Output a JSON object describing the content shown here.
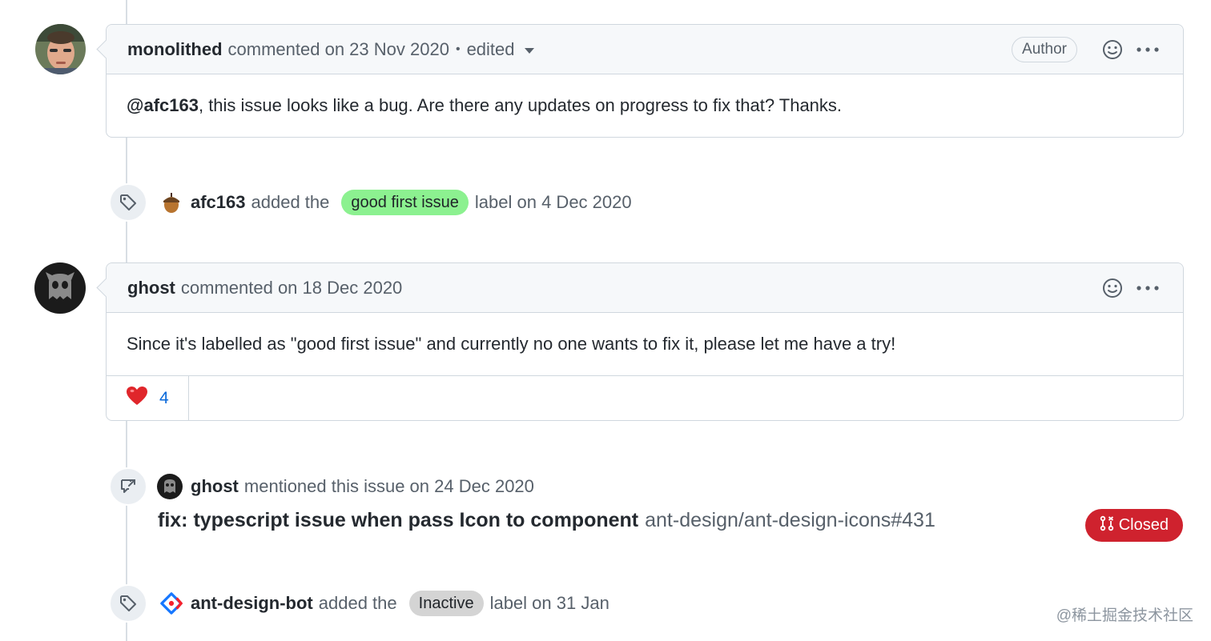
{
  "comments": [
    {
      "author": "monolithed",
      "meta": "commented on 23 Nov 2020",
      "dot": "•",
      "edited": "edited",
      "badge": "Author",
      "mention": "@afc163",
      "body": ", this issue looks like a bug. Are there any updates on progress to fix that? Thanks."
    },
    {
      "author": "ghost",
      "meta": "commented on 18 Dec 2020",
      "body": "Since it's labelled as \"good first issue\" and currently no one wants to fix it, please let me have a try!",
      "reaction": {
        "emoji": "❤️",
        "count": "4"
      }
    }
  ],
  "events": [
    {
      "actor": "afc163",
      "action": "added the",
      "label": "good first issue",
      "label_color": "#8cf190",
      "suffix": "label on 4 Dec 2020"
    },
    {
      "actor": "ghost",
      "action": "mentioned this issue on 24 Dec 2020",
      "ref_title": "fix: typescript issue when pass Icon to component",
      "ref_repo": "ant-design/ant-design-icons#431",
      "status": "Closed",
      "status_color": "#cf222e"
    },
    {
      "actor": "ant-design-bot",
      "action": "added the",
      "label": "Inactive",
      "label_color": "#d4d4d4",
      "suffix": "label on 31 Jan"
    }
  ],
  "watermark": "@稀土掘金技术社区"
}
